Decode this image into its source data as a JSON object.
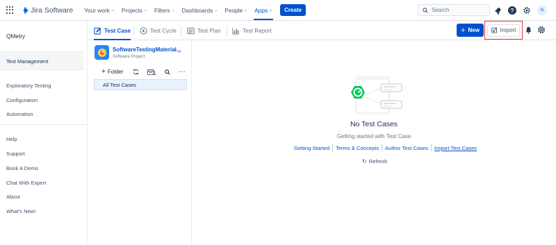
{
  "topnav": {
    "product": "Jira Software",
    "items": [
      "Your work",
      "Projects",
      "Filters",
      "Dashboards",
      "People",
      "Apps"
    ],
    "active_item": "Apps",
    "create_label": "Create",
    "search_placeholder": "Search",
    "avatar_initials": "SI"
  },
  "sidebar": {
    "title": "QMetry",
    "items": [
      "Test Management",
      "Exploratory Testing",
      "Configuration",
      "Automation",
      "Help",
      "Support",
      "Book A Demo",
      "Chat With Expert",
      "About",
      "What's New!"
    ],
    "selected": "Test Management"
  },
  "tabs": [
    "Test Case",
    "Test Cycle",
    "Test Plan",
    "Test Report"
  ],
  "active_tab": "Test Case",
  "actions": {
    "new_label": "New",
    "import_label": "Import"
  },
  "project": {
    "name": "SoftwareTestingMaterial...",
    "type": "Software Project"
  },
  "folders": {
    "add_label": "Folder",
    "root": "All Test Cases"
  },
  "empty_state": {
    "title": "No Test Cases",
    "subtitle": "Getting started with Test Case",
    "links": [
      "Getting Started",
      "Terms & Concepts",
      "Author Test Cases",
      "Import Test Cases"
    ],
    "refresh_label": "Refresh"
  },
  "colors": {
    "accent": "#0052cc",
    "highlight_box": "#e23b3b",
    "illustration_green": "#00c853"
  }
}
